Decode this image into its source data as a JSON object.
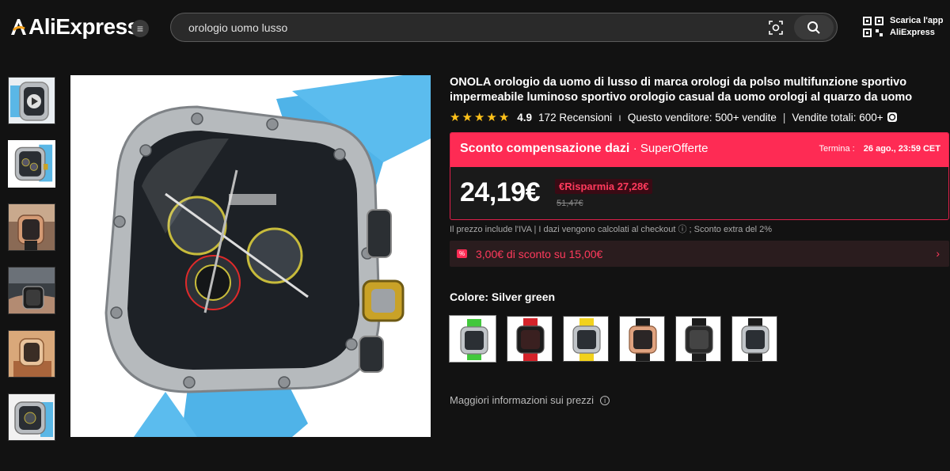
{
  "header": {
    "logo_text": "AliExpress",
    "search_value": "orologio uomo lusso",
    "app_line1": "Scarica l'app",
    "app_line2": "AliExpress"
  },
  "gallery": {
    "thumbnails": [
      "watch-silver-video",
      "watch-silver-front",
      "watch-rose-gold",
      "watch-on-wrist",
      "watch-gold-box",
      "watch-silver-side"
    ],
    "active_index": 1
  },
  "product": {
    "title": "ONOLA orologio da uomo di lusso di marca orologi da polso multifunzione sportivo impermeabile luminoso sportivo orologio casual da uomo orologi al quarzo da uomo",
    "rating": "4.9",
    "reviews": "172 Recensioni",
    "seller_sales": "Questo venditore: 500+ vendite",
    "total_sales": "Vendite totali: 600+",
    "stars": 5
  },
  "promo": {
    "title": "Sconto compensazione dazi",
    "super": "· SuperOfferte",
    "ends_label": "Termina :",
    "ends_value": "26 ago., 23:59 CET",
    "price": "24,19€",
    "save": "€Risparmia 27,28€",
    "old_price": "51,47€"
  },
  "vat_note": "Il prezzo include l'IVA | I dazi vengono calcolati al checkout ⓘ ; Sconto extra del 2%",
  "coupon": {
    "icon": "%",
    "text": "3,00€ di sconto su 15,00€",
    "arrow": "›"
  },
  "color": {
    "label": "Colore: Silver green",
    "options": [
      "Silver green",
      "Black red",
      "Silver yellow",
      "Rose gold",
      "Black",
      "Silver black"
    ],
    "selected": 0
  },
  "more_info": "Maggiori informazioni sui prezzi",
  "colors": {
    "accent": "#fe2b54",
    "background": "#121212",
    "star": "#ffc21a",
    "strap_blue": "#4fb3e8"
  }
}
